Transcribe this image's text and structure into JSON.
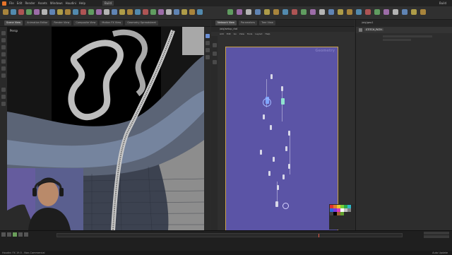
{
  "app": {
    "menu": [
      "File",
      "Edit",
      "Render",
      "Assets",
      "Windows",
      "Houdini",
      "Help"
    ],
    "desktop": "Build",
    "scene_title": "Build"
  },
  "left_pane": {
    "tabs": [
      "Scene View",
      "Animation Editor",
      "Render View",
      "Composite View",
      "Motion FX View",
      "Geometry Spreadsheet"
    ],
    "viewport_label": "Persp"
  },
  "network_pane": {
    "tabs": [
      "Network View",
      "Parameters",
      "Tree View"
    ],
    "path": "/obj/setup_rbd",
    "context_label": "Geometry"
  },
  "right_pane": {
    "path": "/obj/geo1",
    "node_title": "STITCH_PATH"
  },
  "network_menu": [
    "Add",
    "Edit",
    "Go",
    "View",
    "Tools",
    "Layout",
    "Help"
  ],
  "colors": {
    "network_bg": "#5b54a6",
    "accent": "#caa24a",
    "palette": [
      "#e03030",
      "#e07a2a",
      "#e8c82a",
      "#7ad13a",
      "#2aa84a",
      "#2ab9c9",
      "#2a6ad9",
      "#7a3ad9",
      "#d93ab9",
      "#ffffff",
      "#c0c0c0",
      "#808080",
      "#404040",
      "#000000",
      "#a06030",
      "#60a030"
    ]
  },
  "statusbar": {
    "left": "Houdini FX 19.5 - Non-Commercial",
    "right": "Auto Update"
  },
  "icons": {
    "menubar": "houdini-logo-icon",
    "play": "play-icon",
    "network_flag": "display-flag-icon"
  }
}
